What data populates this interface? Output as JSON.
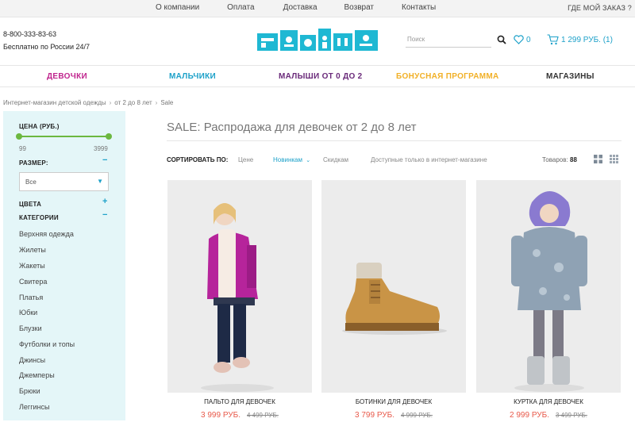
{
  "topbar": {
    "links": [
      "О компании",
      "Оплата",
      "Доставка",
      "Возврат",
      "Контакты"
    ],
    "where_order": "ГДЕ МОЙ ЗАКАЗ ?"
  },
  "header": {
    "phone": "8-800-333-83-63",
    "free_line": "Бесплатно по России 24/7",
    "search_placeholder": "Поиск",
    "favorites_count": "0",
    "cart_total": "1 299 РУБ. (1)"
  },
  "nav": [
    {
      "label": "ДЕВОЧКИ",
      "color": "#c0258e"
    },
    {
      "label": "МАЛЬЧИКИ",
      "color": "#1da1c9"
    },
    {
      "label": "МАЛЫШИ ОТ 0 ДО 2",
      "color": "#6a2a7a"
    },
    {
      "label": "БОНУСНАЯ ПРОГРАММА",
      "color": "#f1b027"
    },
    {
      "label": "МАГАЗИНЫ",
      "color": "#333333"
    }
  ],
  "breadcrumb": [
    "Интернет-магазин детской одежды",
    "от 2 до 8 лет",
    "Sale"
  ],
  "sidebar": {
    "price_title": "ЦЕНА (РУБ.)",
    "price_min": "99",
    "price_max": "3999",
    "size_title": "РАЗМЕР:",
    "size_value": "Все",
    "colors_title": "ЦВЕТА",
    "categories_title": "КАТЕГОРИИ",
    "categories": [
      "Верхняя одежда",
      "Жилеты",
      "Жакеты",
      "Свитера",
      "Платья",
      "Юбки",
      "Блузки",
      "Футболки и топы",
      "Джинсы",
      "Джемперы",
      "Брюки",
      "Леггинсы"
    ]
  },
  "main": {
    "title": "SALE: Распродажа для девочек от 2 до 8 лет",
    "sort_label": "СОРТИРОВАТЬ ПО:",
    "sort_options": [
      "Цене",
      "Новинкам",
      "Скидкам",
      "Доступные только в интернет-магазине"
    ],
    "count_label": "Товаров:",
    "count_value": "88"
  },
  "products": [
    {
      "name": "ПАЛЬТО ДЛЯ ДЕВОЧЕК",
      "price": "3 999 РУБ.",
      "old_price": "4 499 РУБ."
    },
    {
      "name": "БОТИНКИ ДЛЯ ДЕВОЧЕК",
      "price": "3 799 РУБ.",
      "old_price": "4 999 РУБ."
    },
    {
      "name": "КУРТКА ДЛЯ ДЕВОЧЕК",
      "price": "2 999 РУБ.",
      "old_price": "3 499 РУБ."
    }
  ],
  "colors": {
    "accent": "#1da1c9",
    "sale_price": "#e8594a",
    "sidebar_bg": "#e4f6f8",
    "slider": "#6cb840"
  }
}
